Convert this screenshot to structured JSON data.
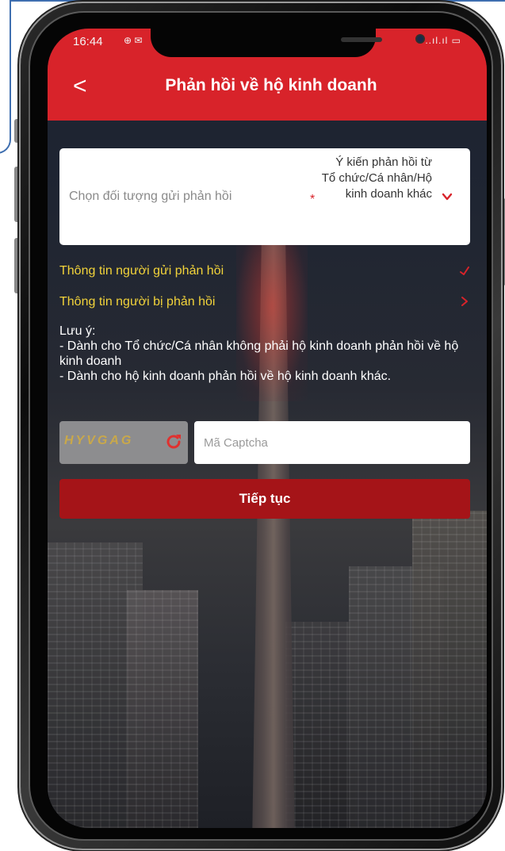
{
  "status_bar": {
    "time": "16:44",
    "left_icons": "⊕ ✉",
    "right_icons": "..ıl.ıl ▭"
  },
  "header": {
    "title": "Phản hồi về hộ kinh doanh",
    "back_symbol": "<"
  },
  "form": {
    "target_select": {
      "label": "Chọn đối tượng gửi phản hồi",
      "required_mark": "*",
      "value": "Ý kiến phản hồi từ Tổ chức/Cá nhân/Hộ kinh doanh khác"
    },
    "sections": [
      {
        "label": "Thông tin người gửi phản hồi",
        "icon": "check-icon"
      },
      {
        "label": "Thông tin người bị phản hồi",
        "icon": "chevron-right-icon"
      }
    ],
    "note": {
      "title": "Lưu ý:",
      "line1": "- Dành cho Tổ chức/Cá nhân không phải hộ kinh doanh phản hồi về hộ kinh doanh",
      "line2": "- Dành cho hộ kinh doanh phản hồi về hộ kinh doanh khác."
    },
    "captcha": {
      "code": "HYVGAG",
      "placeholder": "Mã Captcha"
    },
    "continue_label": "Tiếp tục"
  },
  "colors": {
    "header_red": "#d8232a",
    "button_red": "#a51418",
    "section_yellow": "#f2d33a",
    "accent_red": "#d8232a"
  }
}
